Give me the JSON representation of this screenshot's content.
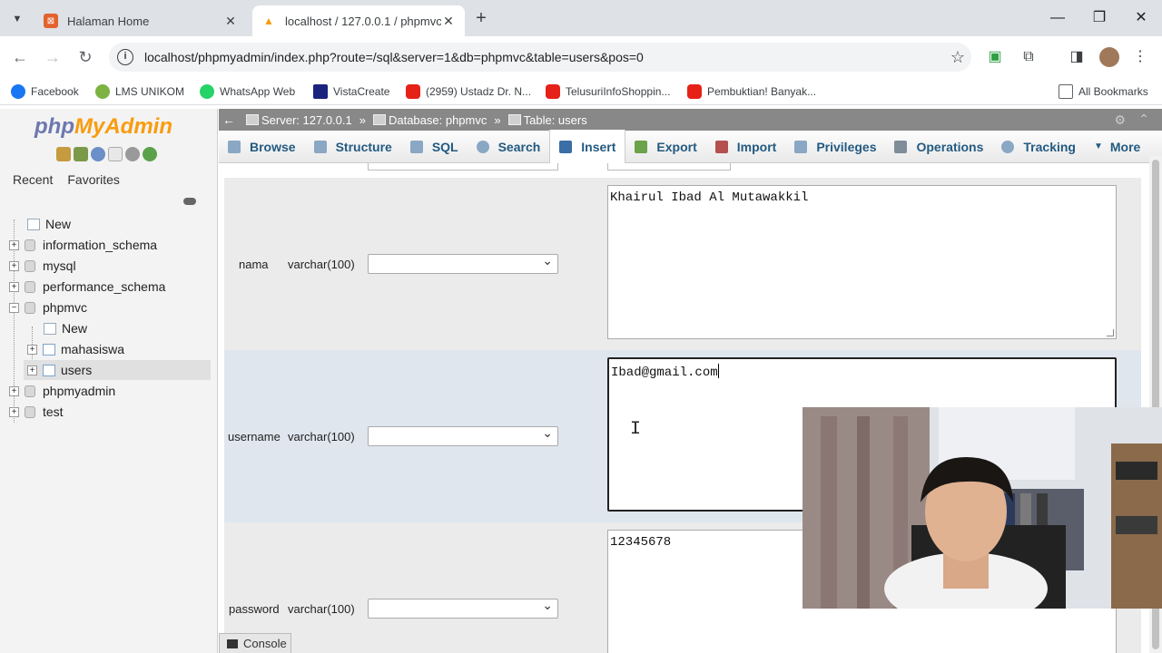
{
  "browser": {
    "tabs": [
      {
        "title": "Halaman Home",
        "active": false
      },
      {
        "title": "localhost / 127.0.0.1 / phpmvc /",
        "active": true
      }
    ],
    "url": "localhost/phpmyadmin/index.php?route=/sql&server=1&db=phpmvc&table=users&pos=0",
    "bookmarks": [
      "Facebook",
      "LMS UNIKOM",
      "WhatsApp Web",
      "VistaCreate",
      "(2959) Ustadz Dr. N...",
      "TelusuriInfoShoppin...",
      "Pembuktian! Banyak..."
    ],
    "all_bookmarks": "All Bookmarks"
  },
  "nav": {
    "logo_php": "php",
    "logo_myadmin": "MyAdmin",
    "tabs": [
      "Recent",
      "Favorites"
    ],
    "tree": {
      "new": "New",
      "info_schema": "information_schema",
      "mysql": "mysql",
      "perf_schema": "performance_schema",
      "phpmvc": "phpmvc",
      "phpmvc_new": "New",
      "mahasiswa": "mahasiswa",
      "users": "users",
      "phpmyadmin": "phpmyadmin",
      "test": "test"
    }
  },
  "breadcrumb": {
    "server": "Server: 127.0.0.1",
    "database": "Database: phpmvc",
    "table": "Table: users",
    "sep": "»"
  },
  "menu": [
    "Browse",
    "Structure",
    "SQL",
    "Search",
    "Insert",
    "Export",
    "Import",
    "Privileges",
    "Operations",
    "Tracking",
    "More"
  ],
  "fields": [
    {
      "name": "nama",
      "type": "varchar(100)",
      "value": "Khairul Ibad Al Mutawakkil"
    },
    {
      "name": "username",
      "type": "varchar(100)",
      "value": "Ibad@gmail.com"
    },
    {
      "name": "password",
      "type": "varchar(100)",
      "value": "12345678"
    }
  ],
  "console_label": "Console",
  "colors": {
    "pma_link": "#235a81",
    "breadcrumb_bg": "#888888",
    "row_alt": "#dfe6ee"
  }
}
